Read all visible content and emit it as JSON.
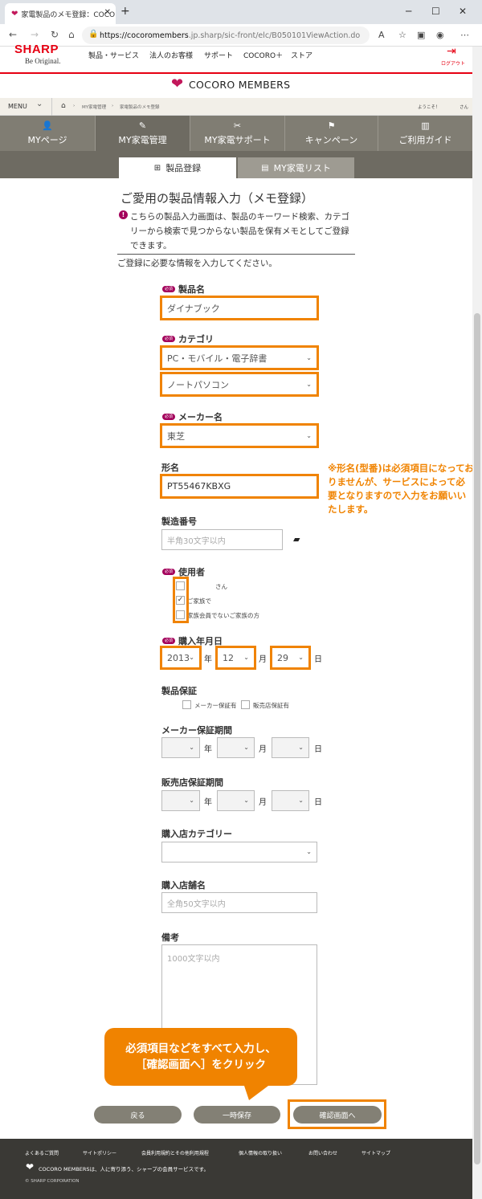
{
  "browser": {
    "tab_title": "家電製品のメモ登録：COCORO M",
    "close_glyph": "✕",
    "newtab_glyph": "+",
    "url_host": "https://cocoromembers",
    "url_rest": ".jp.sharp/sic-front/elc/B050101ViewAction.do"
  },
  "header": {
    "brand": "SHARP",
    "tagline": "Be Original.",
    "nav": [
      "製品・サービス",
      "法人のお客様",
      "サポート",
      "COCORO＋",
      "ストア"
    ],
    "logout": "ログアウト",
    "members_title": "COCORO MEMBERS"
  },
  "crumbs": {
    "menu": "MENU",
    "items": [
      "MY家電管理",
      "家電製品のメモ登録"
    ],
    "welcome": "ようこそ！",
    "san": "さん"
  },
  "mainnav": [
    "MYページ",
    "MY家電管理",
    "MY家電サポート",
    "キャンペーン",
    "ご利用ガイド"
  ],
  "subnav": [
    "製品登録",
    "MY家電リスト"
  ],
  "page": {
    "title": "ご愛用の製品情報入力（メモ登録）",
    "notice": "こちらの製品入力画面は、製品のキーワード検索、カテゴリーから検索で見つからない製品を保有メモとしてご登録できます。",
    "intro": "ご登録に必要な情報を入力してください。"
  },
  "form": {
    "required_badge": "必須",
    "product_name": {
      "label": "製品名",
      "value": "ダイナブック"
    },
    "category": {
      "label": "カテゴリ",
      "value1": "PC・モバイル・電子辞書",
      "value2": "ノートパソコン"
    },
    "maker": {
      "label": "メーカー名",
      "value": "東芝"
    },
    "model": {
      "label": "形名",
      "value": "PT55467KBXG"
    },
    "serial": {
      "label": "製造番号",
      "placeholder": "半角30文字以内"
    },
    "user": {
      "label": "使用者",
      "options": [
        "さん",
        "ご家族で",
        "家族会員でないご家族の方"
      ]
    },
    "purchase_date": {
      "label": "購入年月日",
      "year": "2013",
      "month": "12",
      "day": "29",
      "unit_year": "年",
      "unit_month": "月",
      "unit_day": "日"
    },
    "warranty": {
      "label": "製品保証",
      "opt1": "メーカー保証有",
      "opt2": "販売店保証有"
    },
    "maker_warranty_period": {
      "label": "メーカー保証期間"
    },
    "shop_warranty_period": {
      "label": "販売店保証期間"
    },
    "shop_category": {
      "label": "購入店カテゴリー"
    },
    "shop_name": {
      "label": "購入店舗名",
      "placeholder": "全角50文字以内"
    },
    "notes": {
      "label": "備考",
      "placeholder": "1000文字以内"
    }
  },
  "annotation": {
    "warning": "※形名(型番)は必須項目になっておりませんが、サービスによって必要となりますので入力をお願いいたします。",
    "callout_line1": "必須項目などをすべて入力し、",
    "callout_line2": "［確認画面へ］をクリック"
  },
  "buttons": {
    "back": "戻る",
    "save": "一時保存",
    "confirm": "確認画面へ"
  },
  "footer": {
    "links": [
      "よくあるご質問",
      "サイトポリシー",
      "会員利用規約とその他利用規程",
      "個人情報の取り扱い",
      "お問い合わせ",
      "サイトマップ"
    ],
    "tagline": "COCORO MEMBERSは、人に寄り添う、シャープの会員サービスです。",
    "copyright": "© SHARP CORPORATION"
  },
  "colors": {
    "accent": "#f08300",
    "brand_red": "#e60012",
    "required": "#a3005b",
    "nav": "#807d73"
  }
}
